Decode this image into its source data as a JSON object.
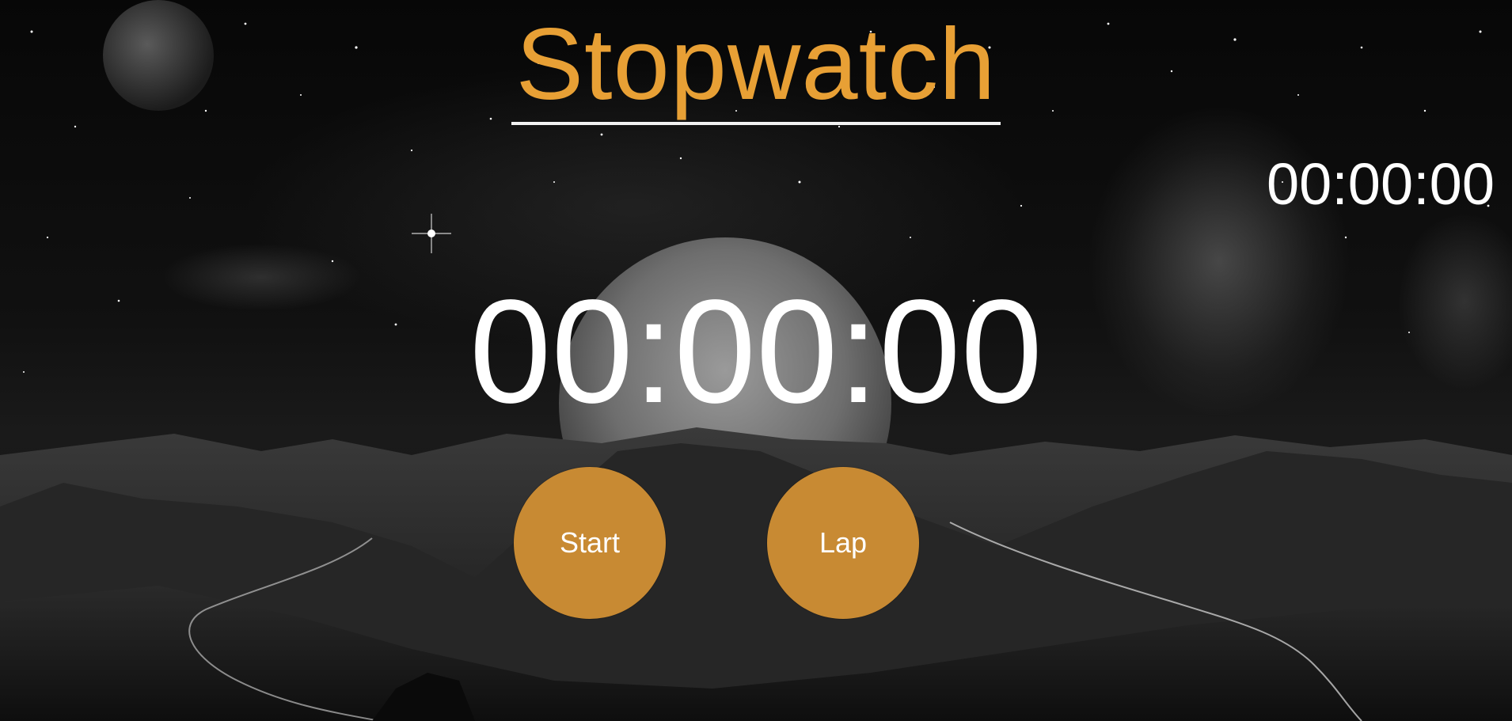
{
  "page": {
    "title": "Stopwatch"
  },
  "stopwatch": {
    "main_time": "00:00:00",
    "lap_time": "00:00:00"
  },
  "controls": {
    "start_label": "Start",
    "lap_label": "Lap"
  },
  "colors": {
    "accent": "#e8a035",
    "button": "#c88a33",
    "text": "#ffffff",
    "underline": "#f2f2f2"
  }
}
